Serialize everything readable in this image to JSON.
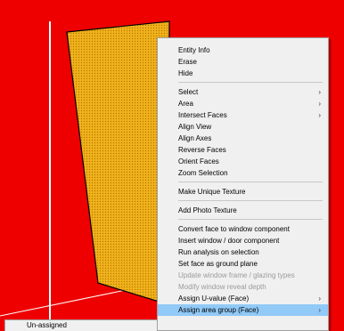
{
  "colors": {
    "background": "#ee0000",
    "face_fill": "#f2b21c",
    "dots": "#b27d00",
    "menu_bg": "#f0f0f0",
    "highlight": "#91c9f7"
  },
  "context_menu": {
    "groups": [
      [
        {
          "label": "Entity Info",
          "arrow": false
        },
        {
          "label": "Erase",
          "arrow": false
        },
        {
          "label": "Hide",
          "arrow": false
        }
      ],
      [
        {
          "label": "Select",
          "arrow": true
        },
        {
          "label": "Area",
          "arrow": true
        },
        {
          "label": "Intersect Faces",
          "arrow": true
        },
        {
          "label": "Align View",
          "arrow": false
        },
        {
          "label": "Align Axes",
          "arrow": false
        },
        {
          "label": "Reverse Faces",
          "arrow": false
        },
        {
          "label": "Orient Faces",
          "arrow": false
        },
        {
          "label": "Zoom Selection",
          "arrow": false
        }
      ],
      [
        {
          "label": "Make Unique Texture",
          "arrow": false
        }
      ],
      [
        {
          "label": "Add Photo Texture",
          "arrow": false
        }
      ],
      [
        {
          "label": "Convert face to window component",
          "arrow": false
        },
        {
          "label": "Insert window / door component",
          "arrow": false
        },
        {
          "label": "Run analysis on selection",
          "arrow": false
        },
        {
          "label": "Set face as ground plane",
          "arrow": false
        },
        {
          "label": "Update window frame / glazing types",
          "arrow": false,
          "disabled": true
        },
        {
          "label": "Modify window reveal depth",
          "arrow": false,
          "disabled": true
        },
        {
          "label": "Assign U-value (Face)",
          "arrow": true
        },
        {
          "label": "Assign area group (Face)",
          "arrow": true,
          "highlighted": true
        }
      ]
    ]
  },
  "submenu": {
    "item": "Un-assigned"
  }
}
